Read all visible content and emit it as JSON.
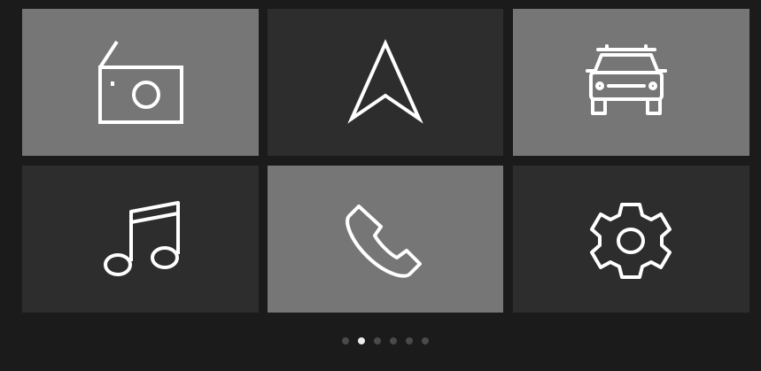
{
  "tiles": [
    {
      "id": "radio",
      "icon": "radio-icon",
      "shade": "light"
    },
    {
      "id": "navigation",
      "icon": "navigation-arrow-icon",
      "shade": "dark"
    },
    {
      "id": "car",
      "icon": "car-icon",
      "shade": "light"
    },
    {
      "id": "music",
      "icon": "music-note-icon",
      "shade": "dark"
    },
    {
      "id": "phone",
      "icon": "phone-icon",
      "shade": "light"
    },
    {
      "id": "settings",
      "icon": "gear-icon",
      "shade": "dark"
    }
  ],
  "pager": {
    "count": 6,
    "active_index": 1
  },
  "colors": {
    "background": "#1b1b1b",
    "tile_light": "#767676",
    "tile_dark": "#2d2d2d",
    "icon_stroke": "#ffffff",
    "dot_inactive": "#4a4a4a",
    "dot_active": "#ececec"
  }
}
